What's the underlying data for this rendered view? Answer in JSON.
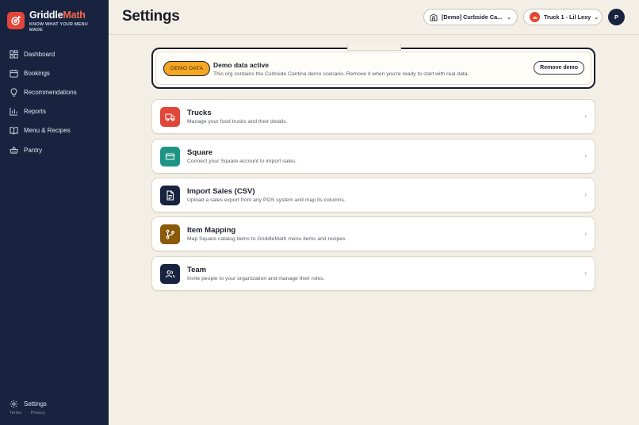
{
  "brand": {
    "name_part1": "Griddle",
    "name_part2": "Math",
    "tagline": "KNOW WHAT YOUR MENU MADE",
    "icon": "target-icon",
    "accent": "#e2463a"
  },
  "sidebar": {
    "items": [
      {
        "label": "Dashboard",
        "icon": "dashboard-icon"
      },
      {
        "label": "Bookings",
        "icon": "calendar-icon"
      },
      {
        "label": "Recommendations",
        "icon": "lightbulb-icon"
      },
      {
        "label": "Reports",
        "icon": "bar-chart-icon"
      },
      {
        "label": "Menu & Recipes",
        "icon": "book-icon"
      },
      {
        "label": "Pantry",
        "icon": "basket-icon"
      }
    ],
    "settings_label": "Settings",
    "footer": {
      "terms": "Terms",
      "separator": "·",
      "privacy": "Privacy"
    }
  },
  "header": {
    "title": "Settings",
    "org_select": "[Demo] Curbside Ca...",
    "truck_select": "Truck 1 - Lil Lexy",
    "avatar_initial": "P"
  },
  "demo_banner": {
    "badge": "DEMO DATA",
    "title": "Demo data active",
    "description": "This org contains the Curbside Cantina demo scenario. Remove it when you're ready to start with real data.",
    "remove_label": "Remove demo"
  },
  "cards": [
    {
      "title": "Trucks",
      "description": "Manage your food trucks and their details.",
      "icon": "truck-icon",
      "color": "#e2463a"
    },
    {
      "title": "Square",
      "description": "Connect your Square account to import sales.",
      "icon": "card-icon",
      "color": "#1f9484"
    },
    {
      "title": "Import Sales (CSV)",
      "description": "Upload a sales export from any POS system and map its columns.",
      "icon": "file-icon",
      "color": "#17233f"
    },
    {
      "title": "Item Mapping",
      "description": "Map Square catalog items to GriddleMath menu items and recipes.",
      "icon": "branch-icon",
      "color": "#8a5a0b"
    },
    {
      "title": "Team",
      "description": "Invite people to your organization and manage their roles.",
      "icon": "users-icon",
      "color": "#17233f"
    }
  ]
}
